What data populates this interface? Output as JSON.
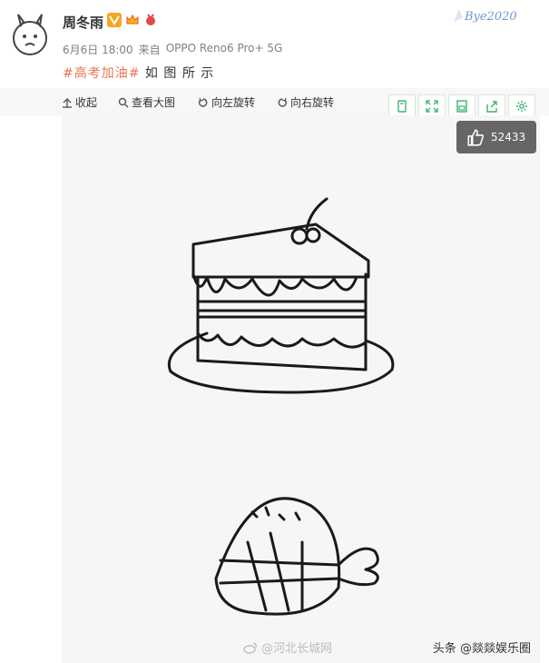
{
  "post": {
    "username": "周冬雨",
    "date": "6月6日 18:00",
    "source_prefix": "来自",
    "source_device": "OPPO Reno6 Pro+ 5G",
    "hashtag": "#高考加油#",
    "text": "如 图 所 示"
  },
  "logo_text": "Bye2020",
  "toolbar": {
    "collapse": "收起",
    "view_large": "查看大图",
    "rotate_left": "向左旋转",
    "rotate_right": "向右旋转"
  },
  "image": {
    "like_count": "52433",
    "watermark_center": "@河北长城网",
    "watermark_right": "头条 @燚燚娱乐圈"
  },
  "colors": {
    "accent": "#eb7350",
    "toolbar_bg": "#f7f7f7",
    "icon_green": "#3bb36f",
    "like_bg": "#666666"
  }
}
